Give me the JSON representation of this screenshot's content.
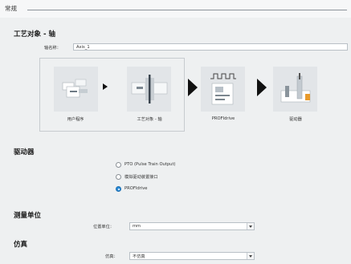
{
  "section": {
    "title": "常规"
  },
  "tech_object": {
    "heading": "工艺对象 - 轴",
    "name_label": "轴名称：",
    "name_value": "Axis_1"
  },
  "workflow": {
    "stages": [
      {
        "label": "用户程序",
        "icon": "user-program-icon"
      },
      {
        "label": "工艺对象 - 轴",
        "icon": "technology-object-axis-icon"
      },
      {
        "label": "PROFIdrive",
        "icon": "profidrive-icon"
      },
      {
        "label": "驱动器",
        "icon": "drive-icon"
      }
    ]
  },
  "drive": {
    "heading": "驱动器",
    "options": [
      {
        "label": "PTO (Pulse Train Output)",
        "selected": false
      },
      {
        "label": "模拟驱动装置接口",
        "selected": false
      },
      {
        "label": "PROFIdrive",
        "selected": true
      }
    ]
  },
  "units": {
    "heading": "测量单位",
    "position_label": "位置单位：",
    "position_value": "mm"
  },
  "simulation": {
    "heading": "仿真",
    "label": "仿真：",
    "value": "不仿真"
  },
  "colors": {
    "accent": "#2a8ad6",
    "border": "#b9c0c6",
    "background": "#eef0f1"
  }
}
